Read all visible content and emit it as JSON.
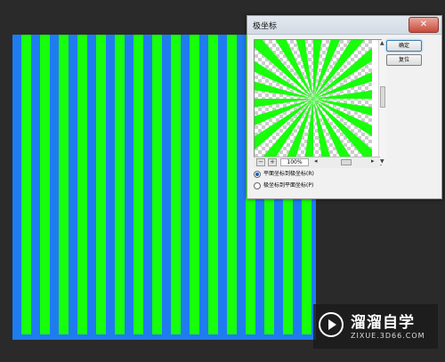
{
  "dialog": {
    "title": "极坐标",
    "close_glyph": "✕",
    "ok_label": "确定",
    "reset_label": "复位",
    "zoom_value": "100%",
    "zoom_minus": "−",
    "zoom_plus": "+",
    "options": [
      {
        "label": "平面坐标到极坐标(R)",
        "checked": true
      },
      {
        "label": "极坐标到平面坐标(P)",
        "checked": false
      }
    ]
  },
  "canvas": {
    "pattern": "vertical stripes",
    "colors": {
      "blue": "#1f7cf0",
      "green": "#17ff0a"
    }
  },
  "preview": {
    "pattern": "radial sunburst",
    "colors": {
      "green": "#17ff0a",
      "transparent_checker": "#cccccc"
    }
  },
  "watermark": {
    "title": "溜溜自学",
    "url": "ZIXUE.3D66.COM"
  }
}
